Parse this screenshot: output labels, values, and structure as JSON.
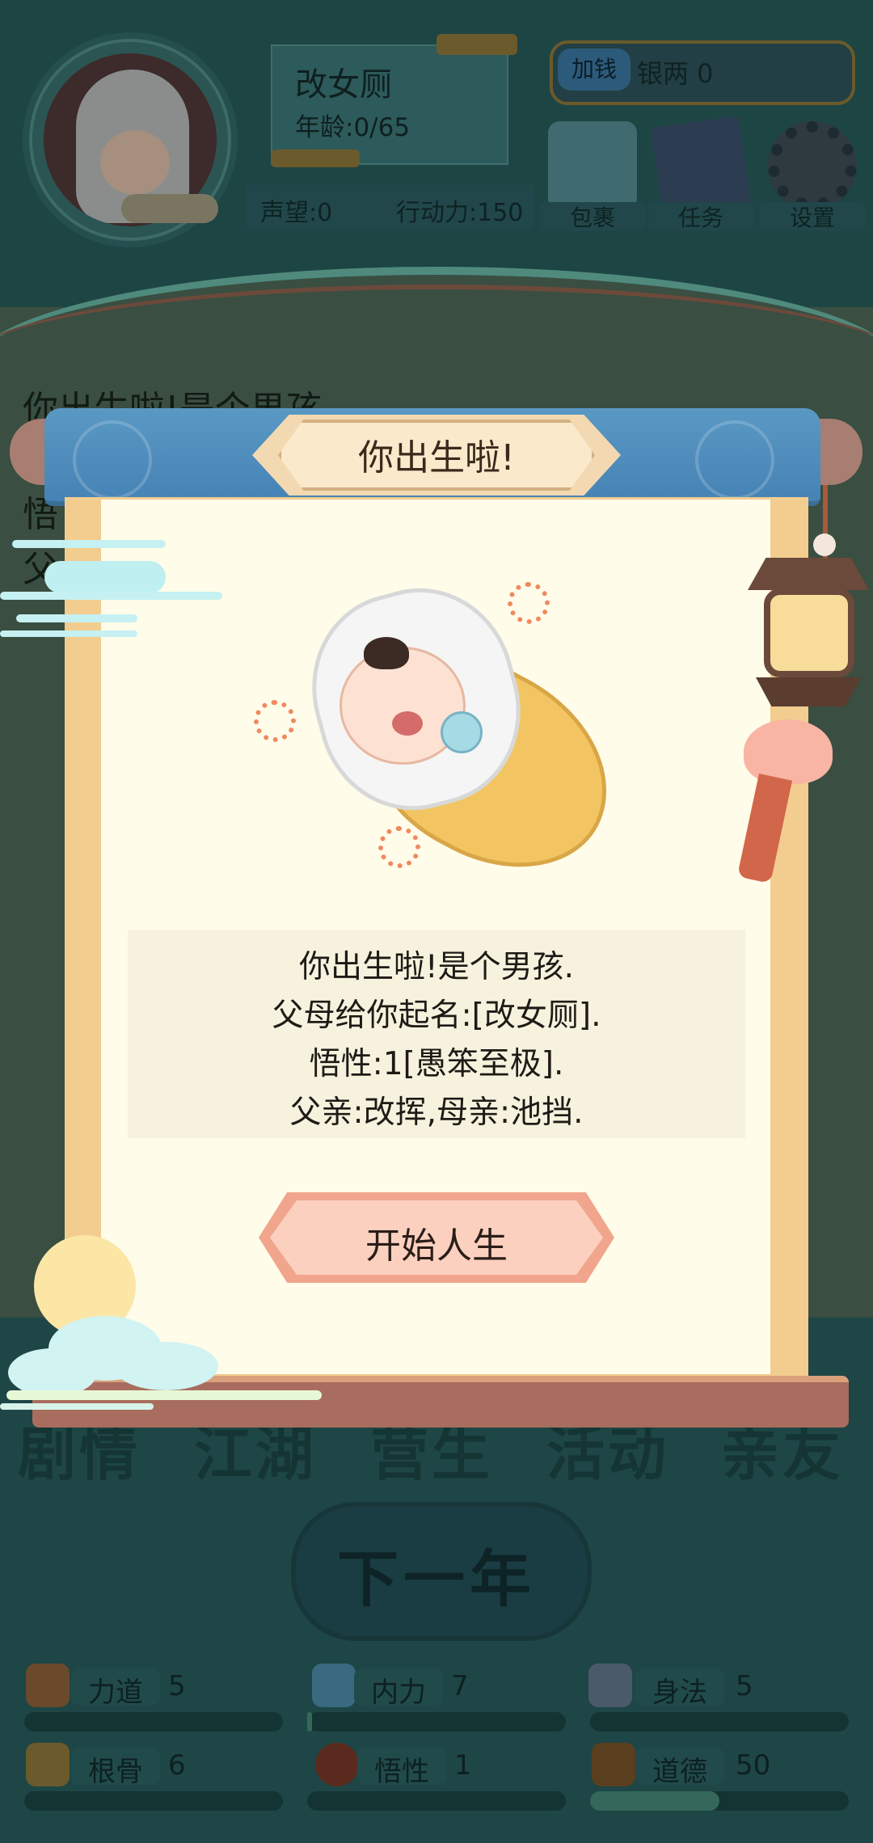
{
  "player": {
    "name": "改女厕",
    "age": "年龄:0/65",
    "reputation": "声望:0",
    "action_points": "行动力:150"
  },
  "currency": {
    "add_button": "加钱",
    "silver": "银两 0"
  },
  "top_menu": {
    "bag": "包裹",
    "task": "任务",
    "settings": "设置"
  },
  "story_log": [
    "你出生啦!是个男孩.",
    "悟",
    "父"
  ],
  "bottom_tabs": [
    "剧情",
    "江湖",
    "营生",
    "活动",
    "亲友"
  ],
  "next_year_button": "下一年",
  "attributes": [
    {
      "label": "力道",
      "value": "5",
      "level": 0.0
    },
    {
      "label": "内力",
      "value": "7",
      "level": 0.02
    },
    {
      "label": "身法",
      "value": "5",
      "level": 0.0
    },
    {
      "label": "根骨",
      "value": "6",
      "level": 0.0
    },
    {
      "label": "悟性",
      "value": "1",
      "level": 0.0
    },
    {
      "label": "道德",
      "value": "50",
      "level": 0.5
    }
  ],
  "modal": {
    "title": "你出生啦!",
    "lines": [
      "你出生啦!是个男孩.",
      "父母给你起名:[改女厕].",
      "悟性:1[愚笨至极].",
      "父亲:改挥,母亲:池挡."
    ],
    "start_button": "开始人生"
  }
}
